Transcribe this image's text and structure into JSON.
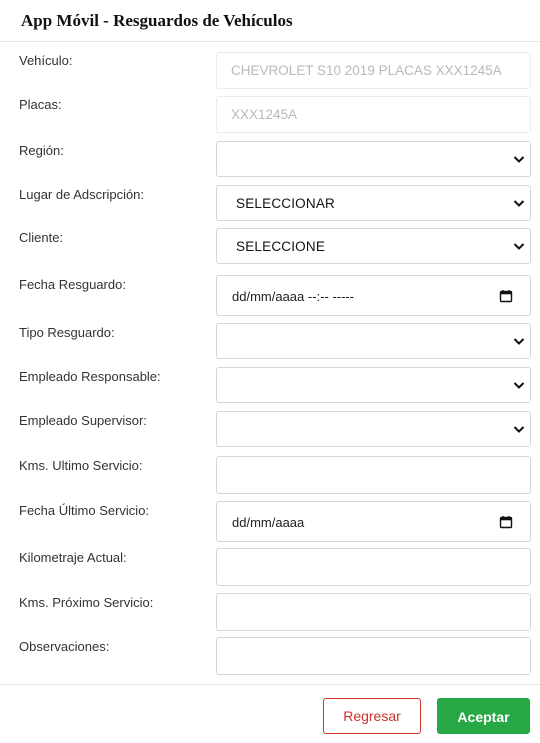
{
  "header": {
    "title": "App Móvil - Resguardos de Vehículos"
  },
  "form": {
    "vehiculo": {
      "label": "Vehículo:",
      "value": "CHEVROLET S10 2019 PLACAS XXX1245A"
    },
    "placas": {
      "label": "Placas:",
      "value": "XXX1245A"
    },
    "region": {
      "label": "Región:",
      "value": ""
    },
    "lugar": {
      "label": "Lugar de Adscripción:",
      "value": "SELECCIONAR"
    },
    "cliente": {
      "label": "Cliente:",
      "value": "SELECCIONE"
    },
    "fecha_resguardo": {
      "label": "Fecha Resguardo:",
      "placeholder": "dd/mm/aaaa --:-- -----"
    },
    "tipo_resguardo": {
      "label": "Tipo Resguardo:",
      "value": ""
    },
    "empleado_responsable": {
      "label": "Empleado Responsable:",
      "value": ""
    },
    "empleado_supervisor": {
      "label": "Empleado Supervisor:",
      "value": ""
    },
    "kms_ultimo": {
      "label": "Kms. Ultimo Servicio:",
      "value": ""
    },
    "fecha_ultimo": {
      "label": "Fecha Último Servicio:",
      "placeholder": "dd/mm/aaaa"
    },
    "kilometraje_actual": {
      "label": "Kilometraje Actual:",
      "value": ""
    },
    "kms_proximo": {
      "label": "Kms. Próximo Servicio:",
      "value": ""
    },
    "observaciones": {
      "label": "Observaciones:",
      "value": ""
    }
  },
  "footer": {
    "back_label": "Regresar",
    "ok_label": "Aceptar"
  },
  "icons": {
    "select_arrow": "chevron-down-icon",
    "date_picker": "calendar-icon"
  },
  "colors": {
    "accent_green": "#28a745",
    "danger_red": "#d0312d",
    "border": "#d6d6d6"
  }
}
